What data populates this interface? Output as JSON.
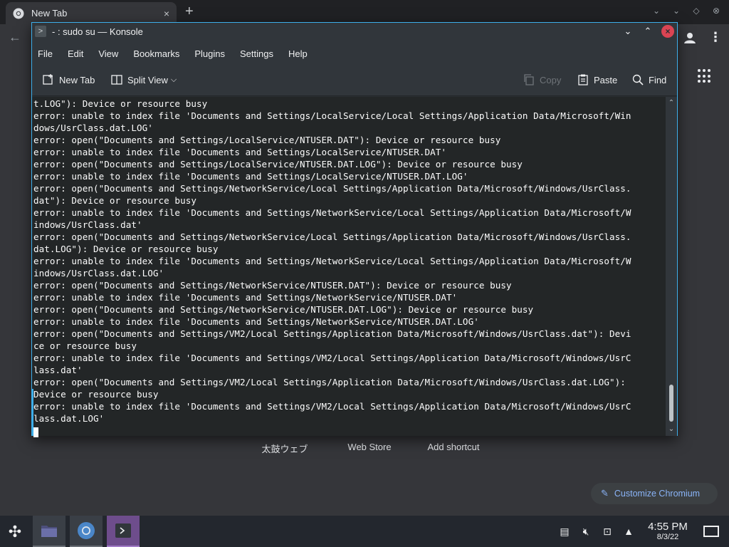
{
  "browser": {
    "tab_title": "New Tab",
    "tab_close_glyph": "×",
    "new_tab_glyph": "+",
    "back_glyph": "←",
    "menu_glyph": "⋮",
    "tab_icon": "chromium-icon",
    "shortcuts": [
      "太鼓ウェブ",
      "Web Store",
      "Add shortcut"
    ],
    "customize_label": "Customize Chromium",
    "accent_color": "#8ab4f8"
  },
  "konsole": {
    "title": "- : sudo su — Konsole",
    "menu": [
      "File",
      "Edit",
      "View",
      "Bookmarks",
      "Plugins",
      "Settings",
      "Help"
    ],
    "toolbar": {
      "new_tab": "New Tab",
      "split_view": "Split View",
      "copy": "Copy",
      "paste": "Paste",
      "find": "Find"
    },
    "accent_color": "#3daee9",
    "close_color": "#da4453",
    "lines": [
      "t.LOG\"): Device or resource busy",
      "error: unable to index file 'Documents and Settings/LocalService/Local Settings/Application Data/Microsoft/Win",
      "dows/UsrClass.dat.LOG'",
      "error: open(\"Documents and Settings/LocalService/NTUSER.DAT\"): Device or resource busy",
      "error: unable to index file 'Documents and Settings/LocalService/NTUSER.DAT'",
      "error: open(\"Documents and Settings/LocalService/NTUSER.DAT.LOG\"): Device or resource busy",
      "error: unable to index file 'Documents and Settings/LocalService/NTUSER.DAT.LOG'",
      "error: open(\"Documents and Settings/NetworkService/Local Settings/Application Data/Microsoft/Windows/UsrClass.",
      "dat\"): Device or resource busy",
      "error: unable to index file 'Documents and Settings/NetworkService/Local Settings/Application Data/Microsoft/W",
      "indows/UsrClass.dat'",
      "error: open(\"Documents and Settings/NetworkService/Local Settings/Application Data/Microsoft/Windows/UsrClass.",
      "dat.LOG\"): Device or resource busy",
      "error: unable to index file 'Documents and Settings/NetworkService/Local Settings/Application Data/Microsoft/W",
      "indows/UsrClass.dat.LOG'",
      "error: open(\"Documents and Settings/NetworkService/NTUSER.DAT\"): Device or resource busy",
      "error: unable to index file 'Documents and Settings/NetworkService/NTUSER.DAT'",
      "error: open(\"Documents and Settings/NetworkService/NTUSER.DAT.LOG\"): Device or resource busy",
      "error: unable to index file 'Documents and Settings/NetworkService/NTUSER.DAT.LOG'",
      "error: open(\"Documents and Settings/VM2/Local Settings/Application Data/Microsoft/Windows/UsrClass.dat\"): Devi",
      "ce or resource busy",
      "error: unable to index file 'Documents and Settings/VM2/Local Settings/Application Data/Microsoft/Windows/UsrC",
      "lass.dat'",
      "error: open(\"Documents and Settings/VM2/Local Settings/Application Data/Microsoft/Windows/UsrClass.dat.LOG\"):",
      "Device or resource busy",
      "error: unable to index file 'Documents and Settings/VM2/Local Settings/Application Data/Microsoft/Windows/UsrC",
      "lass.dat.LOG'"
    ]
  },
  "taskbar": {
    "time": "4:55 PM",
    "date": "8/3/22",
    "items": [
      "file-manager-icon",
      "chromium-icon",
      "konsole-icon"
    ],
    "tray": [
      "clipboard-icon",
      "volume-muted-icon",
      "network-icon",
      "expand-tray-icon"
    ],
    "active_color": "#6e4d8c"
  }
}
